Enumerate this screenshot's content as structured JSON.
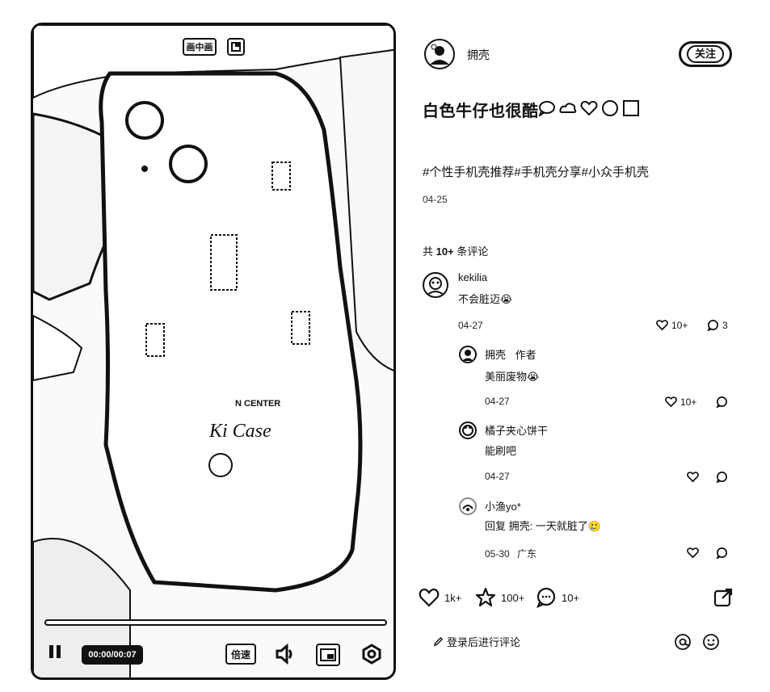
{
  "video": {
    "pip_label": "画中画",
    "current_time": "00:00/00:07",
    "speed_label": "倍速",
    "progress": 0,
    "case_text_top": "N CENTER",
    "case_text_script": "Ki Case"
  },
  "author": {
    "name": "拥壳",
    "follow_label": "关注"
  },
  "post": {
    "title": "白色牛仔也很酷",
    "tags": "#个性手机壳推荐#手机壳分享#小众手机壳",
    "date": "04-25"
  },
  "comments_header": {
    "prefix": "共",
    "count": "10+",
    "suffix": "条评论"
  },
  "comments": [
    {
      "name": "kekilia",
      "text": "不会脏迈",
      "emoji": "😭",
      "date": "04-27",
      "likes": "10+",
      "replies": "3"
    },
    {
      "name": "拥壳",
      "author_tag": "作者",
      "text": "美丽废物",
      "emoji": "😭",
      "date": "04-27",
      "likes": "10+"
    },
    {
      "name": "橘子夹心饼干",
      "text": "能刷吧",
      "date": "04-27"
    },
    {
      "name": "小渔yo*",
      "text": "回复 拥壳: 一天就脏了",
      "emoji": "🥲",
      "date": "05-30",
      "location": "广东"
    }
  ],
  "engagement": {
    "likes": "1k+",
    "favorites": "100+",
    "comments": "10+"
  },
  "comment_input": {
    "placeholder": "登录后进行评论"
  },
  "icons": {
    "like": "heart-icon",
    "favorite": "star-icon",
    "comment": "comment-bubble-icon",
    "share": "share-icon",
    "mention": "at-icon",
    "emoji": "smiley-icon",
    "edit": "pencil-icon",
    "volume": "speaker-icon",
    "fullscreen": "fullscreen-icon",
    "pause": "pause-icon"
  }
}
